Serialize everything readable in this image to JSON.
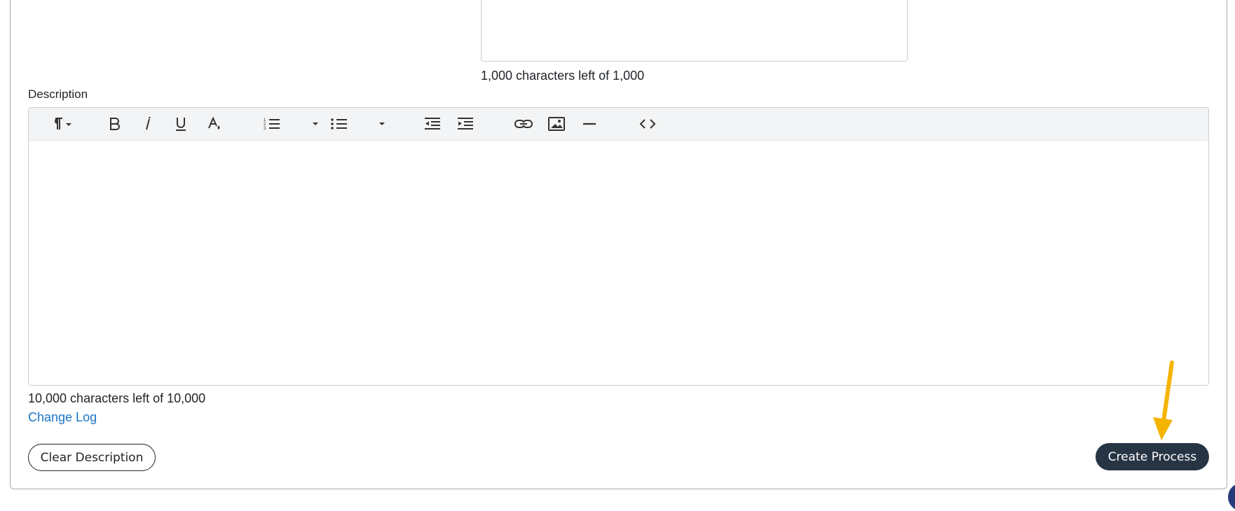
{
  "upper_field": {
    "counter": "1,000 characters left of 1,000"
  },
  "description": {
    "label": "Description",
    "counter": "10,000 characters left of 10,000",
    "toolbar": [
      "paragraph-format-icon",
      "bold-icon",
      "italic-icon",
      "underline-icon",
      "text-color-icon",
      "ordered-list-icon",
      "ordered-list-dropdown-icon",
      "unordered-list-icon",
      "unordered-list-dropdown-icon",
      "outdent-icon",
      "indent-icon",
      "insert-link-icon",
      "insert-image-icon",
      "horizontal-rule-icon",
      "code-view-icon"
    ]
  },
  "links": {
    "change_log": "Change Log"
  },
  "buttons": {
    "clear_description": "Clear Description",
    "create_process": "Create Process"
  },
  "colors": {
    "primary_button": "#263444",
    "link": "#1a73c8",
    "annotation_arrow": "#f5b400"
  }
}
